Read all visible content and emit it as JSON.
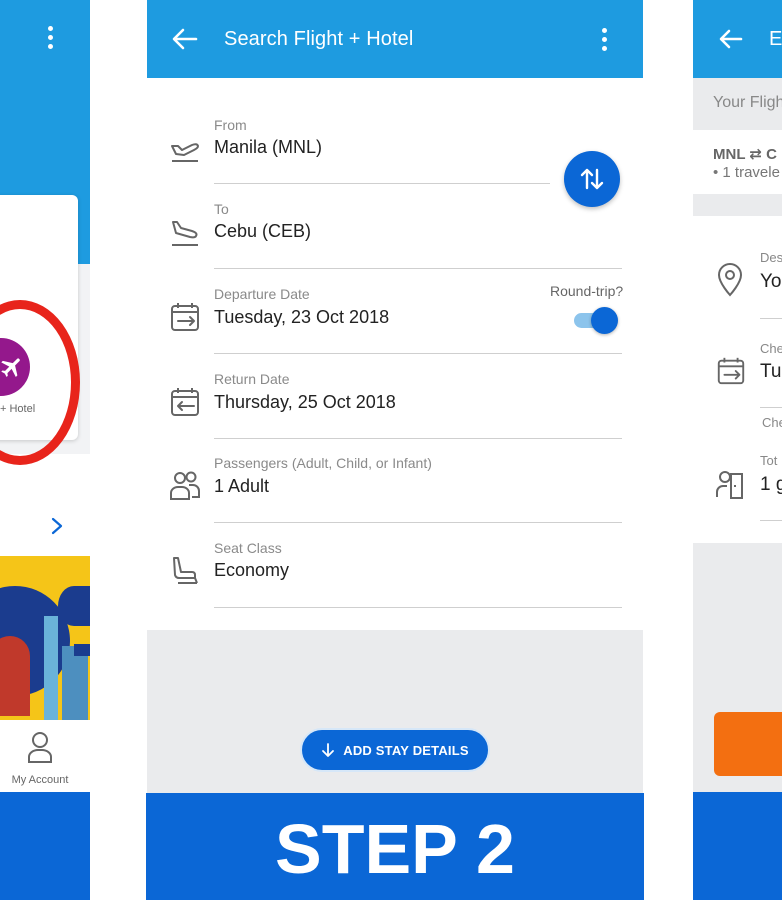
{
  "app": {
    "title": "Search Flight + Hotel",
    "colors": {
      "header": "#1e9be0",
      "primary": "#0b67d6",
      "accent_orange": "#f36f11",
      "highlight_ring": "#e8241b"
    }
  },
  "left_screen": {
    "menu_icon": "kebab-menu-icon",
    "tile_label": "+ Hotel",
    "tile_icon": "plane-icon",
    "account_label": "My Account"
  },
  "form": {
    "from": {
      "label": "From",
      "value": "Manila (MNL)",
      "icon": "takeoff-icon"
    },
    "to": {
      "label": "To",
      "value": "Cebu (CEB)",
      "icon": "landing-icon"
    },
    "departure": {
      "label": "Departure Date",
      "value": "Tuesday, 23 Oct 2018",
      "icon": "calendar-depart-icon"
    },
    "round_trip": {
      "label": "Round-trip?",
      "enabled": true
    },
    "return": {
      "label": "Return Date",
      "value": "Thursday, 25 Oct 2018",
      "icon": "calendar-return-icon"
    },
    "passengers": {
      "label": "Passengers (Adult, Child, or Infant)",
      "value": "1 Adult",
      "icon": "passengers-icon"
    },
    "seat_class": {
      "label": "Seat Class",
      "value": "Economy",
      "icon": "seat-icon"
    }
  },
  "actions": {
    "swap_icon": "swap-icon",
    "add_stay": "ADD STAY DETAILS"
  },
  "banner": {
    "text": "STEP 2"
  },
  "right_screen": {
    "title_fragment": "E",
    "section_fragment": "Your Fligh",
    "route_fragment": "MNL ⇄ C",
    "travelers_fragment": "• 1 travele",
    "dest_label_fragment": "Des",
    "dest_value_fragment": "Yo",
    "checkin_label_fragment": "Che",
    "checkin_value_fragment": "Tue",
    "checkout_label_fragment": "Che",
    "total_label_fragment": "Tot",
    "total_value_fragment": "1 g"
  }
}
